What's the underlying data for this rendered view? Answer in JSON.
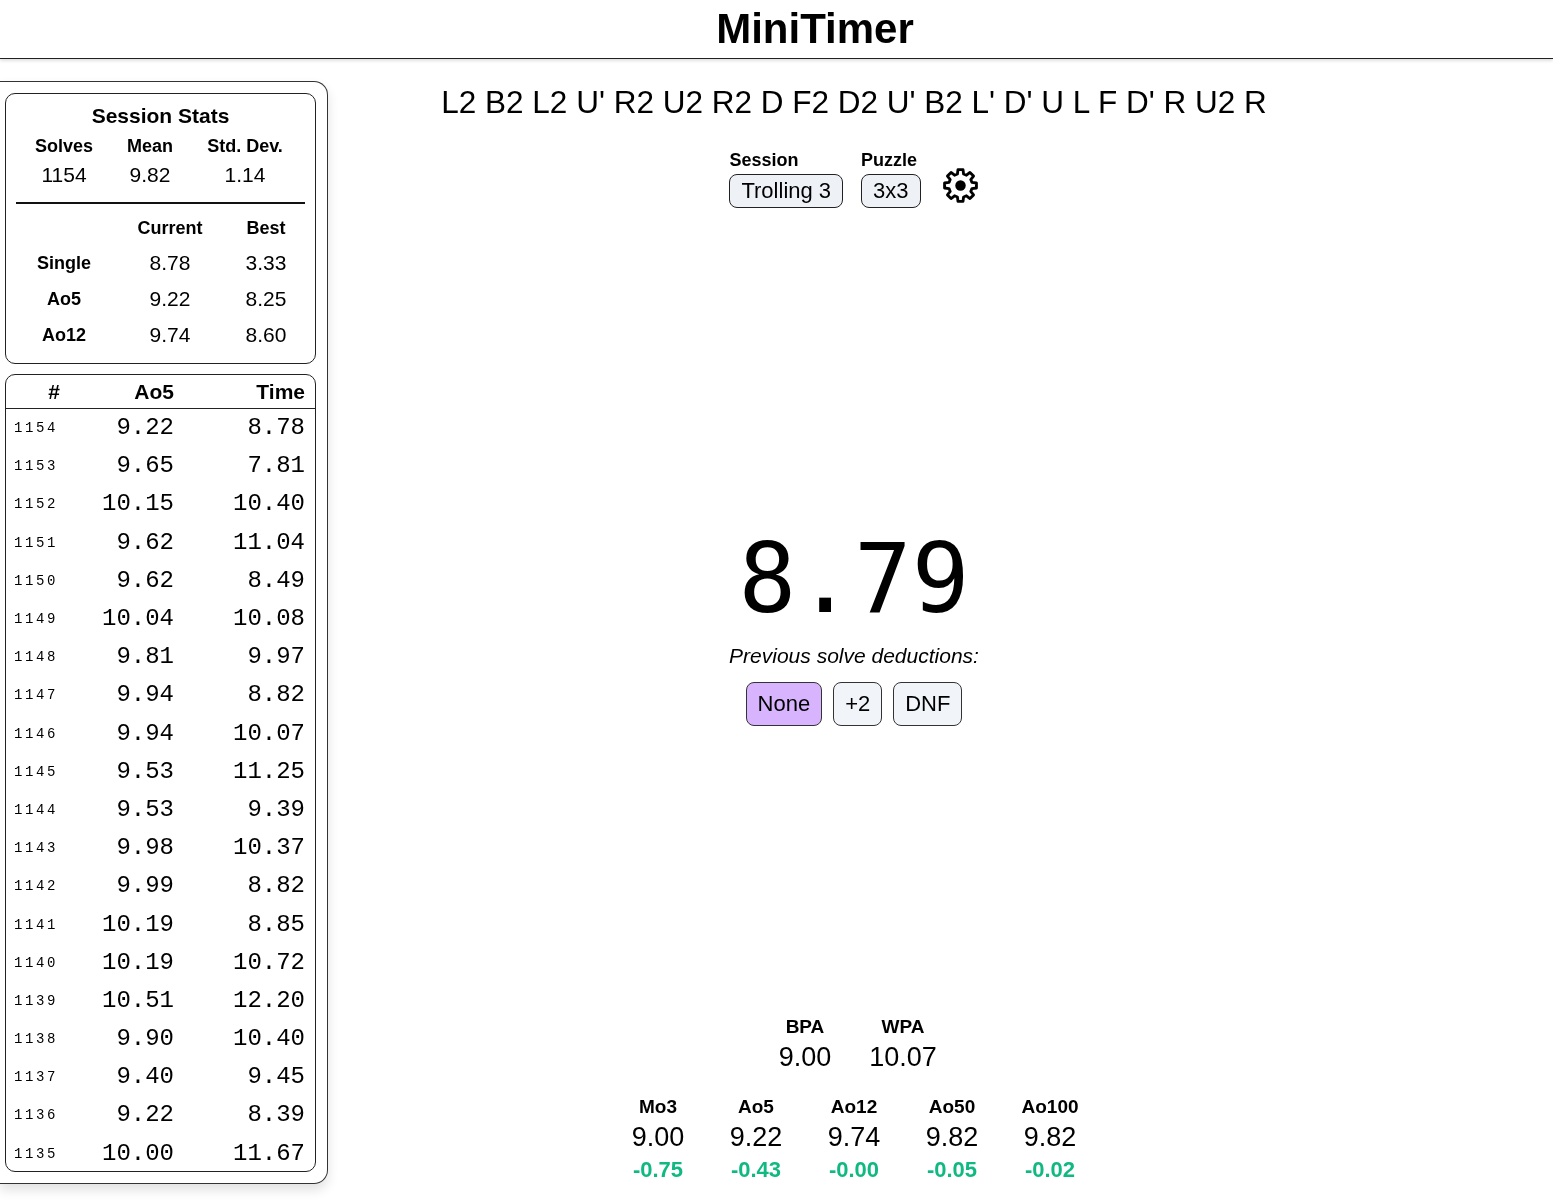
{
  "header": {
    "title": "MiniTimer"
  },
  "session_stats": {
    "title": "Session Stats",
    "summary": [
      {
        "label": "Solves",
        "value": "1154"
      },
      {
        "label": "Mean",
        "value": "9.82"
      },
      {
        "label": "Std. Dev.",
        "value": "1.14"
      }
    ],
    "records": {
      "columns": [
        "Current",
        "Best"
      ],
      "rows": [
        {
          "label": "Single",
          "current": "8.78",
          "best": "3.33"
        },
        {
          "label": "Ao5",
          "current": "9.22",
          "best": "8.25"
        },
        {
          "label": "Ao12",
          "current": "9.74",
          "best": "8.60"
        }
      ]
    }
  },
  "solves_table": {
    "columns": [
      "#",
      "Ao5",
      "Time"
    ],
    "rows": [
      {
        "number": "1154",
        "ao5": "9.22",
        "time": "8.78"
      },
      {
        "number": "1153",
        "ao5": "9.65",
        "time": "7.81"
      },
      {
        "number": "1152",
        "ao5": "10.15",
        "time": "10.40"
      },
      {
        "number": "1151",
        "ao5": "9.62",
        "time": "11.04"
      },
      {
        "number": "1150",
        "ao5": "9.62",
        "time": "8.49"
      },
      {
        "number": "1149",
        "ao5": "10.04",
        "time": "10.08"
      },
      {
        "number": "1148",
        "ao5": "9.81",
        "time": "9.97"
      },
      {
        "number": "1147",
        "ao5": "9.94",
        "time": "8.82"
      },
      {
        "number": "1146",
        "ao5": "9.94",
        "time": "10.07"
      },
      {
        "number": "1145",
        "ao5": "9.53",
        "time": "11.25"
      },
      {
        "number": "1144",
        "ao5": "9.53",
        "time": "9.39"
      },
      {
        "number": "1143",
        "ao5": "9.98",
        "time": "10.37"
      },
      {
        "number": "1142",
        "ao5": "9.99",
        "time": "8.82"
      },
      {
        "number": "1141",
        "ao5": "10.19",
        "time": "8.85"
      },
      {
        "number": "1140",
        "ao5": "10.19",
        "time": "10.72"
      },
      {
        "number": "1139",
        "ao5": "10.51",
        "time": "12.20"
      },
      {
        "number": "1138",
        "ao5": "9.90",
        "time": "10.40"
      },
      {
        "number": "1137",
        "ao5": "9.40",
        "time": "9.45"
      },
      {
        "number": "1136",
        "ao5": "9.22",
        "time": "8.39"
      },
      {
        "number": "1135",
        "ao5": "10.00",
        "time": "11.67"
      }
    ]
  },
  "scramble": "L2 B2 L2 U' R2 U2 R2 D F2 D2 U' B2 L' D' U L F D' R U2 R",
  "selectors": [
    {
      "label": "Session",
      "value": "Trolling 3"
    },
    {
      "label": "Puzzle",
      "value": "3x3"
    }
  ],
  "timer": "8.79",
  "deductions": {
    "label": "Previous solve deductions:",
    "options": [
      {
        "label": "None",
        "selected": true
      },
      {
        "label": "+2",
        "selected": false
      },
      {
        "label": "DNF",
        "selected": false
      }
    ]
  },
  "best_worst": [
    {
      "label": "BPA",
      "value": "9.00"
    },
    {
      "label": "WPA",
      "value": "10.07"
    }
  ],
  "averages": [
    {
      "label": "Mo3",
      "value": "9.00",
      "delta": "-0.75"
    },
    {
      "label": "Ao5",
      "value": "9.22",
      "delta": "-0.43"
    },
    {
      "label": "Ao12",
      "value": "9.74",
      "delta": "-0.00"
    },
    {
      "label": "Ao50",
      "value": "9.82",
      "delta": "-0.05"
    },
    {
      "label": "Ao100",
      "value": "9.82",
      "delta": "-0.02"
    }
  ]
}
